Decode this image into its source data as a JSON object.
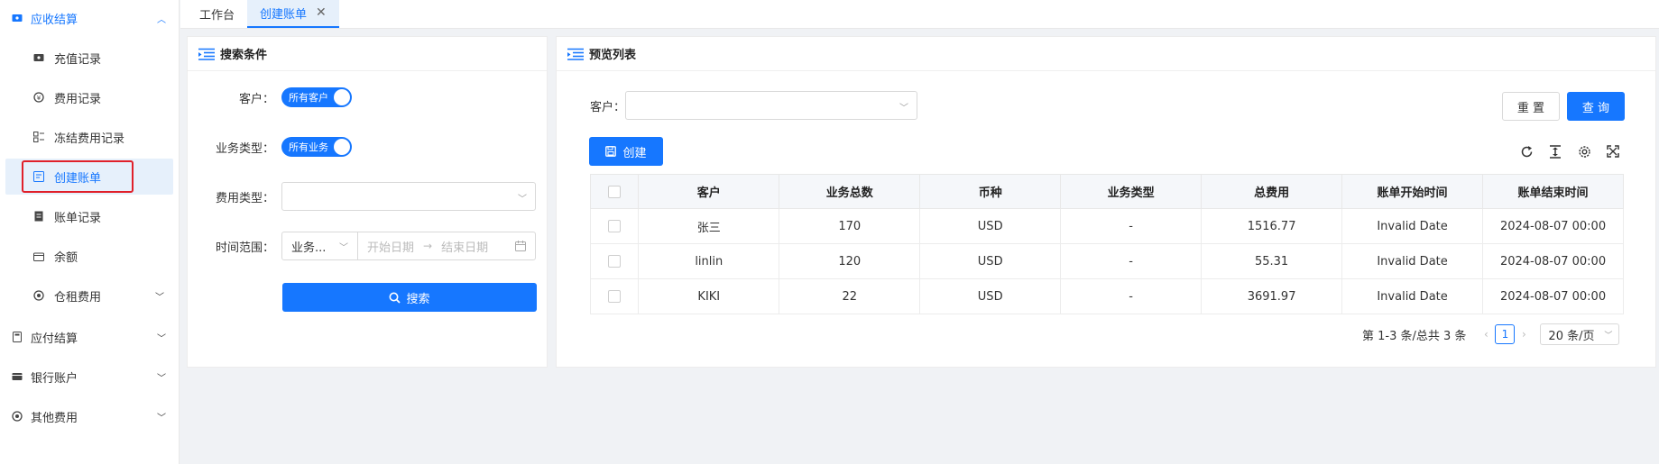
{
  "sidebar": {
    "groups": [
      {
        "label": "应收结算",
        "icon": "ticket-icon"
      },
      {
        "label": "应付结算",
        "icon": "calculator-icon"
      },
      {
        "label": "银行账户",
        "icon": "card-icon"
      },
      {
        "label": "其他费用",
        "icon": "coin-icon"
      }
    ],
    "sub_items": [
      {
        "label": "充值记录",
        "icon": "ticket-icon"
      },
      {
        "label": "费用记录",
        "icon": "money-icon"
      },
      {
        "label": "冻结费用记录",
        "icon": "frozen-list-icon"
      },
      {
        "label": "创建账单",
        "icon": "bill-create-icon"
      },
      {
        "label": "账单记录",
        "icon": "bill-record-icon"
      },
      {
        "label": "余额",
        "icon": "wallet-icon"
      },
      {
        "label": "仓租费用",
        "icon": "coin-icon"
      }
    ]
  },
  "tabs": [
    {
      "label": "工作台"
    },
    {
      "label": "创建账单"
    }
  ],
  "search_panel": {
    "title": "搜索条件",
    "customer_label": "客户：",
    "customer_toggle": "所有客户",
    "business_label": "业务类型：",
    "business_toggle": "所有业务",
    "fee_type_label": "费用类型：",
    "fee_type_value": "",
    "time_label": "时间范围：",
    "time_mode": "业务...",
    "start_placeholder": "开始日期",
    "range_arrow": "→",
    "end_placeholder": "结束日期",
    "search_button": "搜索"
  },
  "preview_panel": {
    "title": "预览列表",
    "customer_label": "客户：",
    "customer_value": "",
    "reset_button": "重 置",
    "query_button": "查 询",
    "create_button": "创建",
    "columns": [
      "客户",
      "业务总数",
      "币种",
      "业务类型",
      "总费用",
      "账单开始时间",
      "账单结束时间"
    ],
    "rows": [
      [
        "张三",
        "170",
        "USD",
        "-",
        "1516.77",
        "Invalid Date",
        "2024-08-07 00:00"
      ],
      [
        "linlin",
        "120",
        "USD",
        "-",
        "55.31",
        "Invalid Date",
        "2024-08-07 00:00"
      ],
      [
        "KIKI",
        "22",
        "USD",
        "-",
        "3691.97",
        "Invalid Date",
        "2024-08-07 00:00"
      ]
    ],
    "pagination": {
      "summary": "第 1-3 条/总共 3 条",
      "current_page": "1",
      "page_size": "20 条/页"
    }
  },
  "colors": {
    "primary": "#1677ff",
    "active_bg": "#e6f0fb",
    "highlight": "#e0202a"
  }
}
